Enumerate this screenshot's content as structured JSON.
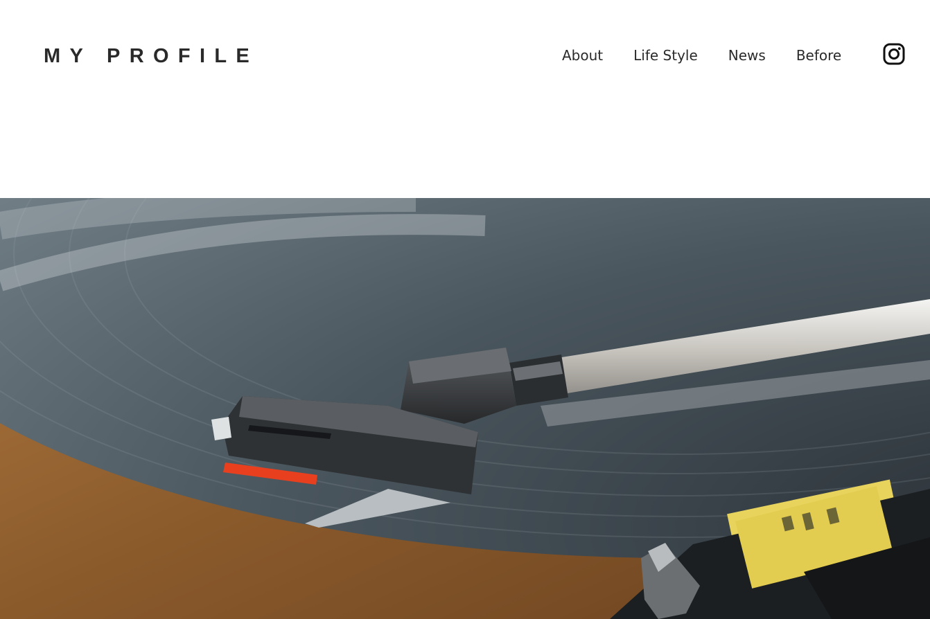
{
  "site": {
    "logo": "MY PROFILE"
  },
  "nav": {
    "items": [
      {
        "label": "About"
      },
      {
        "label": "Life Style"
      },
      {
        "label": "News"
      },
      {
        "label": "Before"
      }
    ],
    "instagram_icon": "instagram-icon"
  },
  "hero": {
    "image": "turntable-record-tonearm-photo",
    "colors": {
      "record": "#3a454c",
      "wood": "#8a5a2b",
      "label": "#e8d45c",
      "accent_red": "#e8401e"
    }
  }
}
